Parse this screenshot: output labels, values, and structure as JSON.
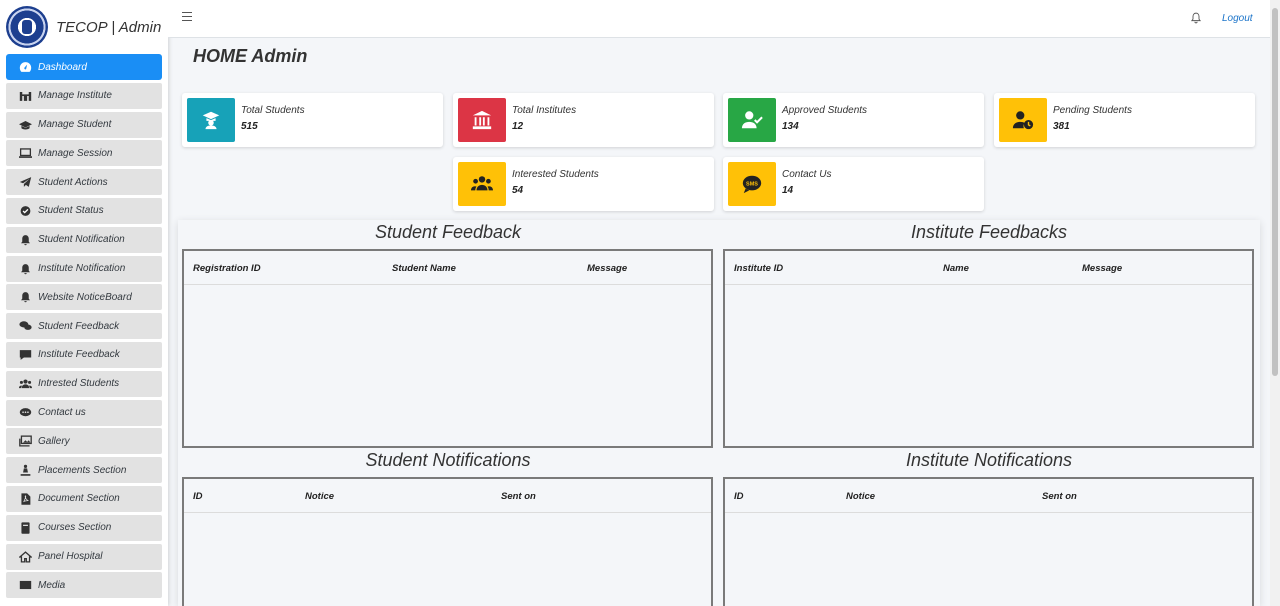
{
  "brand": {
    "title": "TECOP | Admin"
  },
  "sidebar": {
    "items": [
      {
        "label": "Dashboard",
        "icon": "dashboard-icon",
        "active": true
      },
      {
        "label": "Manage Institute",
        "icon": "institute-icon"
      },
      {
        "label": "Manage Student",
        "icon": "graduation-cap-icon"
      },
      {
        "label": "Manage Session",
        "icon": "laptop-icon"
      },
      {
        "label": "Student Actions",
        "icon": "paper-plane-icon"
      },
      {
        "label": "Student Status",
        "icon": "check-circle-icon"
      },
      {
        "label": "Student Notification",
        "icon": "bell-icon"
      },
      {
        "label": "Institute Notification",
        "icon": "bell-icon"
      },
      {
        "label": "Website NoticeBoard",
        "icon": "bell-icon"
      },
      {
        "label": "Student Feedback",
        "icon": "comments-icon"
      },
      {
        "label": "Institute Feedback",
        "icon": "comment-icon"
      },
      {
        "label": "Intrested Students",
        "icon": "users-icon"
      },
      {
        "label": "Contact us",
        "icon": "comment-dots-icon"
      },
      {
        "label": "Gallery",
        "icon": "images-icon"
      },
      {
        "label": "Placements Section",
        "icon": "person-icon"
      },
      {
        "label": "Document Section",
        "icon": "pdf-icon"
      },
      {
        "label": "Courses Section",
        "icon": "book-icon"
      },
      {
        "label": "Panel Hospital",
        "icon": "home-icon"
      },
      {
        "label": "Media",
        "icon": "media-icon"
      }
    ]
  },
  "topbar": {
    "logout": "Logout"
  },
  "page": {
    "title": "HOME Admin"
  },
  "cards": [
    {
      "label": "Total Students",
      "value": "515",
      "color": "#17a2b8",
      "icon": "graduate-icon"
    },
    {
      "label": "Total Institutes",
      "value": "12",
      "color": "#dc3545",
      "icon": "institution-icon"
    },
    {
      "label": "Approved Students",
      "value": "134",
      "color": "#28a745",
      "icon": "user-check-icon"
    },
    {
      "label": "Pending Students",
      "value": "381",
      "color": "#ffc107",
      "icon": "user-clock-icon"
    },
    {
      "label": "Interested Students",
      "value": "54",
      "color": "#ffc107",
      "icon": "users-icon"
    },
    {
      "label": "Contact Us",
      "value": "14",
      "color": "#ffc107",
      "icon": "sms-icon"
    }
  ],
  "sections": {
    "student_feedback": {
      "title": "Student Feedback",
      "columns": [
        "Registration ID",
        "Student Name",
        "Message"
      ]
    },
    "institute_feedback": {
      "title": "Institute Feedbacks",
      "columns": [
        "Institute ID",
        "Name",
        "Message"
      ]
    },
    "student_notifications": {
      "title": "Student Notifications",
      "columns": [
        "ID",
        "Notice",
        "Sent on"
      ]
    },
    "institute_notifications": {
      "title": "Institute Notifications",
      "columns": [
        "ID",
        "Notice",
        "Sent on"
      ]
    }
  }
}
